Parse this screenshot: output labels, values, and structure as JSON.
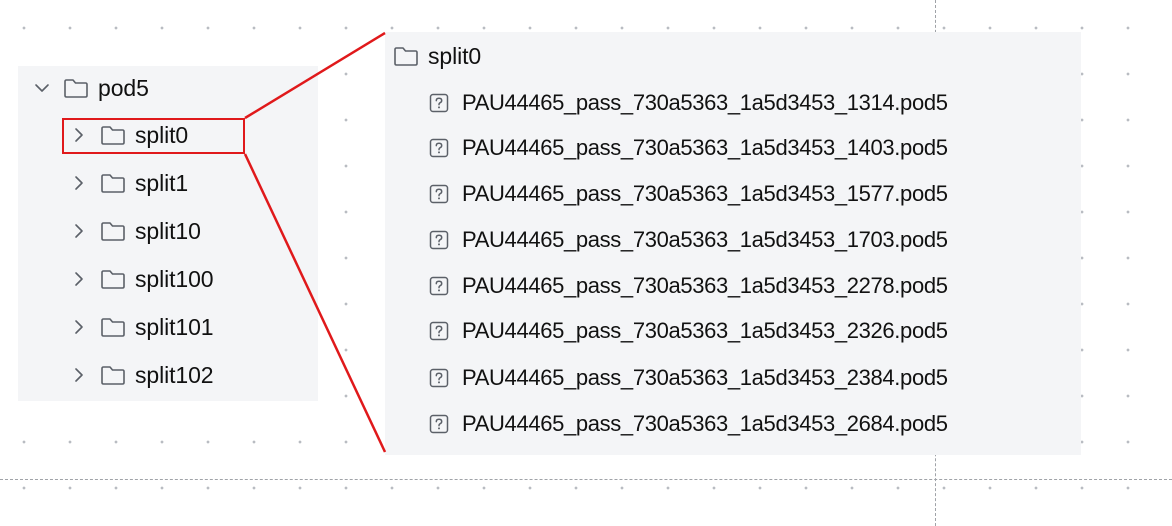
{
  "tree": {
    "root": {
      "label": "pod5",
      "expanded": true,
      "icon": "folder-icon"
    },
    "children": [
      {
        "label": "split0",
        "expanded": false,
        "highlighted": true
      },
      {
        "label": "split1",
        "expanded": false
      },
      {
        "label": "split10",
        "expanded": false
      },
      {
        "label": "split100",
        "expanded": false
      },
      {
        "label": "split101",
        "expanded": false
      },
      {
        "label": "split102",
        "expanded": false
      }
    ]
  },
  "detail": {
    "folder_label": "split0",
    "files": [
      "PAU44465_pass_730a5363_1a5d3453_1314.pod5",
      "PAU44465_pass_730a5363_1a5d3453_1403.pod5",
      "PAU44465_pass_730a5363_1a5d3453_1577.pod5",
      "PAU44465_pass_730a5363_1a5d3453_1703.pod5",
      "PAU44465_pass_730a5363_1a5d3453_2278.pod5",
      "PAU44465_pass_730a5363_1a5d3453_2326.pod5",
      "PAU44465_pass_730a5363_1a5d3453_2384.pod5",
      "PAU44465_pass_730a5363_1a5d3453_2684.pod5"
    ]
  },
  "colors": {
    "highlight": "#e0191b",
    "panel_bg": "#f4f5f7",
    "icon_stroke": "#5b6068"
  }
}
